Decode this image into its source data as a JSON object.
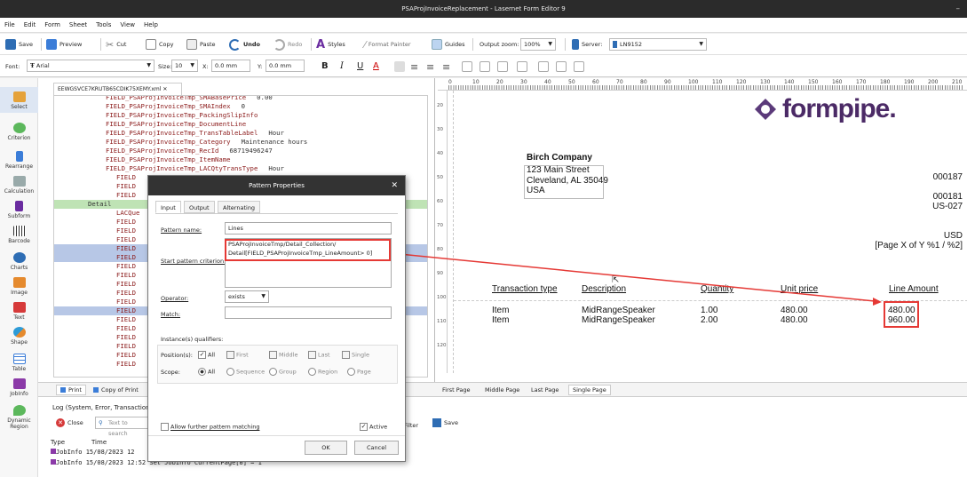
{
  "window": {
    "title": "PSAProjInvoiceReplacement - Lasernet Form Editor 9",
    "minimize_glyph": "–"
  },
  "menu": [
    "File",
    "Edit",
    "Form",
    "Sheet",
    "Tools",
    "View",
    "Help"
  ],
  "toolbar": {
    "save": "Save",
    "preview": "Preview",
    "cut": "Cut",
    "copy": "Copy",
    "paste": "Paste",
    "undo": "Undo",
    "redo": "Redo",
    "styles": "Styles",
    "format_painter": "Format Painter",
    "guides": "Guides",
    "output_zoom_label": "Output zoom:",
    "output_zoom_value": "100%",
    "server_label": "Server:",
    "server_value": "LN9152"
  },
  "format_bar": {
    "font_label": "Font:",
    "font_value": "Arial",
    "size_label": "Size:",
    "size_value": "10",
    "x_label": "X:",
    "x_value": "0.0 mm",
    "y_label": "Y:",
    "y_value": "0.0 mm",
    "bold": "B",
    "italic": "I",
    "underline": "U",
    "color": "A"
  },
  "sidebar": [
    {
      "label": "Select",
      "icon": "select-icon"
    },
    {
      "label": "Criterion",
      "icon": "criterion-icon"
    },
    {
      "label": "Rearrange",
      "icon": "rearrange-icon"
    },
    {
      "label": "Calculation",
      "icon": "calculation-icon"
    },
    {
      "label": "Subform",
      "icon": "subform-icon"
    },
    {
      "label": "Barcode",
      "icon": "barcode-icon"
    },
    {
      "label": "Charts",
      "icon": "charts-icon"
    },
    {
      "label": "Image",
      "icon": "image-icon"
    },
    {
      "label": "Text",
      "icon": "text-icon"
    },
    {
      "label": "Shape",
      "icon": "shape-icon"
    },
    {
      "label": "Table",
      "icon": "table-icon"
    },
    {
      "label": "JobInfo",
      "icon": "jobinfo-icon"
    },
    {
      "label": "Dynamic Region",
      "icon": "dynamic-region-icon"
    }
  ],
  "code": {
    "tab": "EEWGSVCE7KRUTB65CDIK75XEMY.xml",
    "lines": [
      {
        "text": "FIELD_PSAProjInvoiceTmp_SMABasePrice",
        "value": "0.00"
      },
      {
        "text": "FIELD_PSAProjInvoiceTmp_SMAIndex",
        "value": "0"
      },
      {
        "text": "FIELD_PSAProjInvoiceTmp_PackingSlipInfo",
        "value": ""
      },
      {
        "text": "FIELD_PSAProjInvoiceTmp_DocumentLine",
        "value": ""
      },
      {
        "text": "FIELD_PSAProjInvoiceTmp_TransTableLabel",
        "value": "Hour"
      },
      {
        "text": "FIELD_PSAProjInvoiceTmp_Category",
        "value": "Maintenance hours"
      },
      {
        "text": "FIELD_PSAProjInvoiceTmp_RecId",
        "value": "68719496247"
      },
      {
        "text": "FIELD_PSAProjInvoiceTmp_ItemName",
        "value": ""
      },
      {
        "text": "FIELD_PSAProjInvoiceTmp_LACQtyTransType",
        "value": "Hour"
      },
      {
        "text": "FIELD",
        "value": ""
      },
      {
        "text": "FIELD",
        "value": ""
      },
      {
        "text": "FIELD",
        "value": ""
      },
      {
        "text": "Detail",
        "value": ""
      },
      {
        "text": "LACQue",
        "value": ""
      },
      {
        "text": "FIELD",
        "value": ""
      },
      {
        "text": "FIELD",
        "value": ""
      },
      {
        "text": "FIELD",
        "value": ""
      },
      {
        "text": "FIELD",
        "value": ""
      },
      {
        "text": "FIELD",
        "value": ""
      },
      {
        "text": "FIELD",
        "value": ""
      },
      {
        "text": "FIELD",
        "value": ""
      },
      {
        "text": "FIELD",
        "value": ""
      },
      {
        "text": "FIELD",
        "value": ""
      },
      {
        "text": "FIELD",
        "value": ""
      },
      {
        "text": "FIELD",
        "value": ""
      },
      {
        "text": "FIELD",
        "value": ""
      },
      {
        "text": "FIELD",
        "value": ""
      },
      {
        "text": "FIELD",
        "value": ""
      },
      {
        "text": "FIELD",
        "value": ""
      },
      {
        "text": "FIELD",
        "value": ""
      },
      {
        "text": "FIELD",
        "value": ""
      }
    ],
    "bottom_tabs": [
      "Print",
      "Copy of Print"
    ]
  },
  "ruler": {
    "marks": [
      "0",
      "10",
      "20",
      "30",
      "40",
      "50",
      "60",
      "70",
      "80",
      "90",
      "100",
      "110",
      "120",
      "130",
      "140",
      "150",
      "160",
      "170",
      "180",
      "190",
      "200",
      "210"
    ]
  },
  "vruler": {
    "marks": [
      "20",
      "30",
      "40",
      "50",
      "60",
      "70",
      "80",
      "90",
      "100",
      "110",
      "120"
    ]
  },
  "invoice": {
    "logo": "formpipe.",
    "company": "Birch Company",
    "address": [
      "123 Main Street",
      "Cleveland, AL 35049",
      "USA"
    ],
    "right_fields": [
      "000187",
      "000181",
      "US-027",
      "USD",
      "[Page X of Y %1 / %2]"
    ],
    "headers": [
      "Transaction type",
      "Description",
      "Quantity",
      "Unit price",
      "Line Amount"
    ],
    "rows": [
      {
        "type": "Item",
        "desc": "MidRangeSpeaker",
        "qty": "1.00",
        "price": "480.00",
        "amount": "480.00"
      },
      {
        "type": "Item",
        "desc": "MidRangeSpeaker",
        "qty": "2.00",
        "price": "480.00",
        "amount": "960.00"
      }
    ]
  },
  "design_tabs": [
    "First Page",
    "Middle Page",
    "Last Page",
    "Single Page"
  ],
  "log": {
    "title": "Log (System, Error, Transaction",
    "close": "Close",
    "search_placeholder": "Text to search",
    "filter": "Filter",
    "save": "Save",
    "columns": [
      "Type",
      "Time"
    ],
    "entries": [
      "JobInfo 15/08/2023 12",
      "JobInfo 15/08/2023 12:52 Set JobInfo CurrentPage[0] = 1"
    ]
  },
  "dialog": {
    "title": "Pattern Properties",
    "tabs": [
      "Input",
      "Output",
      "Alternating"
    ],
    "pattern_name_label": "Pattern name:",
    "pattern_name_value": "Lines",
    "start_criterion_label": "Start pattern criterion:",
    "start_criterion_value": "PSAProjInvoiceTmp/Detail_Collection/\nDetail[FIELD_PSAProjInvoiceTmp_LineAmount> 0]",
    "operator_label": "Operator:",
    "operator_value": "exists",
    "match_label": "Match:",
    "qualifiers_label": "Instance(s) qualifiers:",
    "positions_label": "Position(s):",
    "positions": [
      "All",
      "First",
      "Middle",
      "Last",
      "Single"
    ],
    "scope_label": "Scope:",
    "scopes": [
      "All",
      "Sequence",
      "Group",
      "Region",
      "Page"
    ],
    "allow_label": "Allow further pattern matching",
    "active_label": "Active",
    "ok": "OK",
    "cancel": "Cancel"
  },
  "colors": {
    "highlight": "#e53935",
    "code_field": "#8b1a1a",
    "logo": "#4b2a66"
  }
}
